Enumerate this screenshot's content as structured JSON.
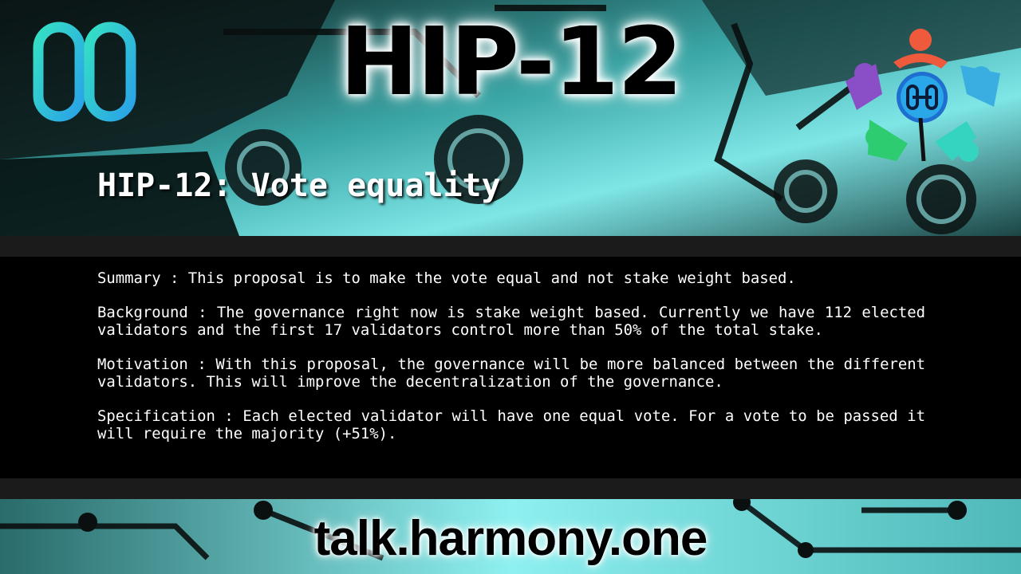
{
  "header": {
    "main_title": "HIP-12",
    "subtitle": "HIP-12: Vote equality"
  },
  "body": {
    "paragraphs": [
      "Summary : This proposal is to make the vote equal and not stake weight based.",
      "Background : The governance right now is stake weight based. Currently we have 112 elected validators and the first 17 validators control more than 50% of the total stake.",
      "Motivation : With this proposal, the governance will be more balanced between the different validators. This will improve the decentralization of the governance.",
      "Specification : Each elected validator will have one equal vote. For a vote to be passed it will require the majority (+51%)."
    ]
  },
  "footer": {
    "url": "talk.harmony.one"
  },
  "logos": {
    "left": "harmony-logo-icon",
    "right": "harmony-community-logo-icon"
  },
  "colors": {
    "teal": "#6fe0e0",
    "panel": "#000000",
    "strip": "#1b1b1b",
    "text": "#ffffff"
  }
}
